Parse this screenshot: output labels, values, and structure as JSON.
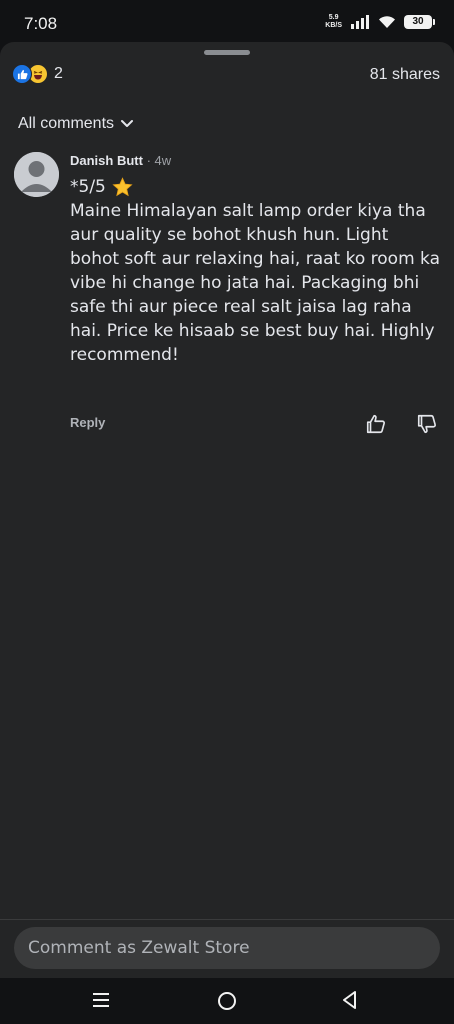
{
  "status_bar": {
    "time": "7:08",
    "net_speed_value": "5.9",
    "net_speed_unit": "KB/S",
    "battery": "30"
  },
  "reactions": {
    "count": "2",
    "types": [
      "like-icon",
      "haha-icon"
    ],
    "like_color": "#1b74e4",
    "haha_color": "#f7c531"
  },
  "shares": "81 shares",
  "filter": {
    "label": "All comments"
  },
  "comments": [
    {
      "author": "Danish Butt",
      "time_ago": "4w",
      "rating": "*5/5",
      "text": "Maine Himalayan salt lamp order kiya tha aur quality se bohot khush hun. Light bohot soft aur relaxing hai, raat ko room ka vibe hi change ho jata hai. Packaging bhi safe thi aur piece real salt jaisa lag raha hai. Price ke hisaab se best buy hai. Highly recommend!",
      "reply_label": "Reply"
    }
  ],
  "composer": {
    "placeholder": "Comment as Zewalt Store"
  },
  "colors": {
    "background": "#242526",
    "surface": "#3a3b3c",
    "text": "#e4e6eb",
    "muted": "#b0b3b8"
  }
}
